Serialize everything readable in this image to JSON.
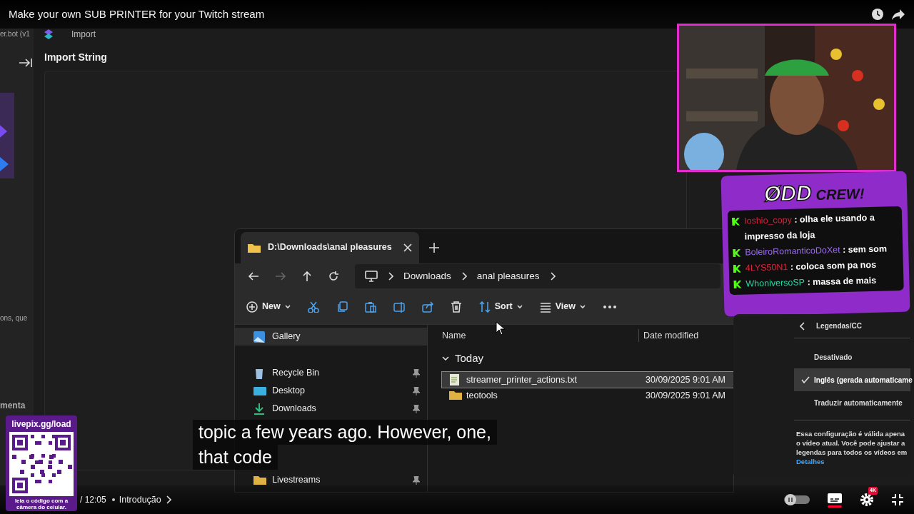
{
  "title": "Make your own SUB PRINTER for your Twitch stream",
  "app": {
    "sidebar_texts": [
      "er.bot (v1",
      "ons, que",
      "menta"
    ],
    "tab": "Import",
    "heading": "Import String"
  },
  "explorer": {
    "tab_title": "D:\\Downloads\\anal pleasures",
    "breadcrumb": [
      "Downloads",
      "anal pleasures"
    ],
    "toolbar": [
      {
        "kind": "new",
        "label": "New"
      },
      {
        "kind": "sort",
        "label": "Sort"
      },
      {
        "kind": "view",
        "label": "View"
      }
    ],
    "nav": [
      {
        "label": "Gallery",
        "kind": "gallery",
        "selected": true,
        "pinned": false
      },
      {
        "label": "Recycle Bin",
        "kind": "bin",
        "selected": false,
        "pinned": true
      },
      {
        "label": "Desktop",
        "kind": "desktop",
        "selected": false,
        "pinned": true
      },
      {
        "label": "Downloads",
        "kind": "download",
        "selected": false,
        "pinned": true
      },
      {
        "label": "Livestreams",
        "kind": "folder",
        "selected": false,
        "pinned": true
      }
    ],
    "columns": [
      "Name",
      "Date modified"
    ],
    "group": "Today",
    "files": [
      {
        "name": "streamer_printer_actions.txt",
        "date": "30/09/2025 9:01 AM",
        "kind": "text",
        "selected": true
      },
      {
        "name": "teotools",
        "date": "30/09/2025 9:01 AM",
        "kind": "folder",
        "selected": false
      }
    ]
  },
  "chat": {
    "logo": [
      "ØDD",
      "CREW!"
    ],
    "messages": [
      {
        "user": "Ioshio_copy",
        "color": "#d8203c",
        "text": " : olha ele usando a impresso da loja"
      },
      {
        "user": "BoleiroRomanticoDoXet",
        "color": "#9a6cf0",
        "text": " : sem som"
      },
      {
        "user": "4LYS50N1",
        "color": "#e0243c",
        "text": " : coloca som pa nos"
      },
      {
        "user": "WhoniversoSP",
        "color": "#25d6a0",
        "text": " : massa de mais"
      }
    ]
  },
  "qr": {
    "url": "livepix.gg/load",
    "caption": "leia o código com a câmera do celular."
  },
  "captions": [
    "topic a few years ago. However, one,",
    "that code"
  ],
  "settings_menu": {
    "title": "Legendas/CC",
    "options": [
      {
        "label": "Desativado",
        "selected": false
      },
      {
        "label": "Inglês (gerada automaticame",
        "selected": true
      },
      {
        "label": "Traduzir automaticamente",
        "selected": false
      }
    ],
    "note": "Essa configuração é válida apena o vídeo atual. Você pode ajustar a legendas para todos os vídeos em",
    "note_link": "Detalhes"
  },
  "controls": {
    "time": "/ 12:05",
    "chapter": "Introdução",
    "autoplay_on": false,
    "captions_on": true,
    "quality_badge": "4K"
  }
}
